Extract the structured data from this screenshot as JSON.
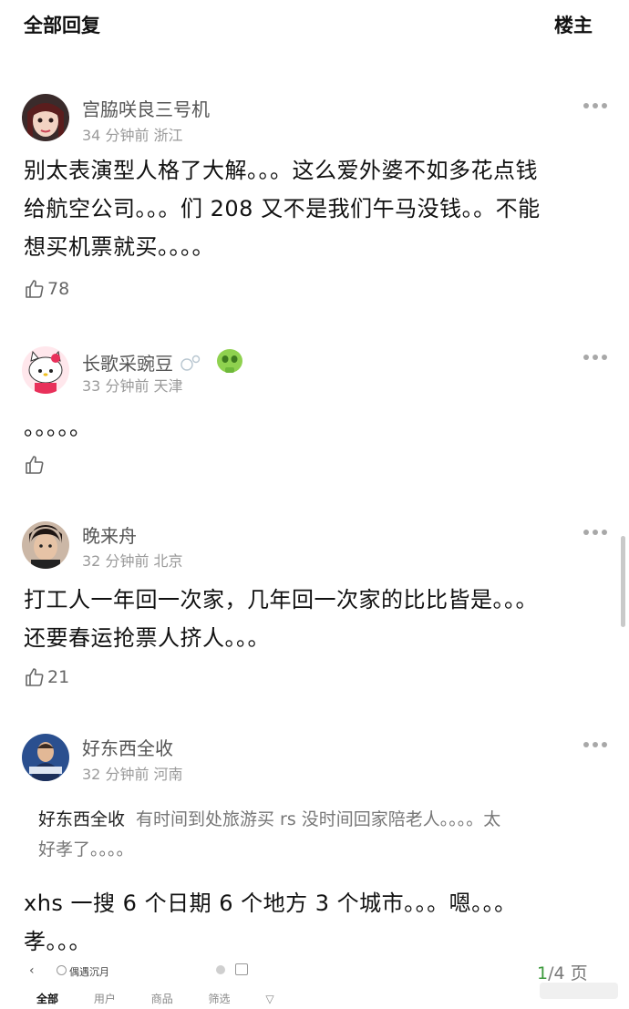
{
  "header": {
    "title": "全部回复",
    "owner": "楼主"
  },
  "comments": [
    {
      "username": "宫脇咲良三号机",
      "time": "34 分钟前",
      "location": "浙江",
      "body_lines": [
        "别太表演型人格了大解。。。这么爱外婆不如多花点钱",
        "给航空公司。。。们 208 又不是我们午马没钱。。不能",
        "想买机票就买。。。。"
      ],
      "likes": "78",
      "avatar_icon": "anime-girl-avatar"
    },
    {
      "username": "长歌采豌豆",
      "time": "33 分钟前",
      "location": "天津",
      "body_lines": [
        "。。。。。"
      ],
      "likes": "",
      "avatar_icon": "hello-kitty-avatar",
      "badges": [
        "bubble-badge-icon",
        "green-skull-badge-icon"
      ]
    },
    {
      "username": "晚来舟",
      "time": "32 分钟前",
      "location": "北京",
      "body_lines": [
        "打工人一年回一次家，几年回一次家的比比皆是。。。",
        "还要春运抢票人挤人。。。"
      ],
      "likes": "21",
      "avatar_icon": "man-portrait-avatar"
    },
    {
      "username": "好东西全收",
      "time": "32 分钟前",
      "location": "河南",
      "quote": {
        "name": "好东西全收",
        "line1": "有时间到处旅游买 rs 没时间回家陪老人。。。。太",
        "line2": "好孝了。。。。"
      },
      "body_lines": [
        "xhs 一搜 6 个日期 6 个地方 3 个城市。。。嗯。。。",
        "孝。。。"
      ],
      "likes": "",
      "avatar_icon": "tv-host-avatar"
    }
  ],
  "footer": {
    "search_text": "偶遇沉月",
    "tabs": [
      "全部",
      "用户",
      "商品",
      "筛选"
    ],
    "pager_current": "1",
    "pager_rest": "/4 页"
  },
  "colors": {
    "accent_green": "#3d9a3d",
    "text_primary": "#111111",
    "text_secondary": "#9a9a9a"
  }
}
